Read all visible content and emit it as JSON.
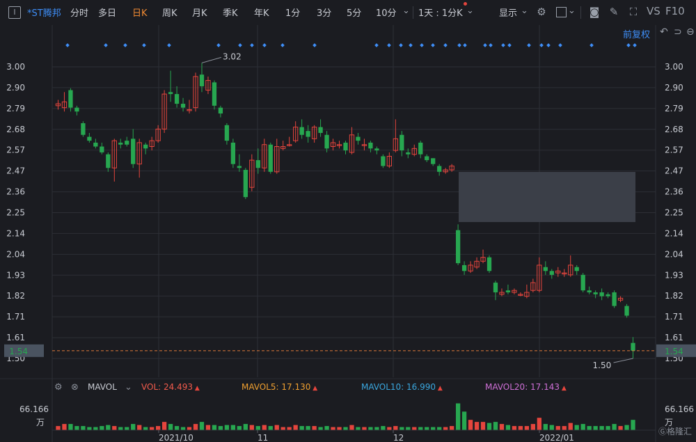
{
  "toolbar": {
    "title_icon": "window-icon",
    "stock_name": "*ST腾邦",
    "periods": [
      "分时",
      "多日",
      "日K",
      "周K",
      "月K",
      "季K",
      "年K",
      "1分",
      "3分",
      "5分",
      "10分"
    ],
    "active_period": "日K",
    "range_select": "1天 : 1分K",
    "display_label": "显示",
    "vs_label": "VS",
    "f10_label": "F10"
  },
  "chart_header": {
    "adjust_label": "前复权"
  },
  "price_axis": {
    "ticks": [
      "3.00",
      "2.90",
      "2.79",
      "2.68",
      "2.57",
      "2.47",
      "2.36",
      "2.25",
      "2.14",
      "2.04",
      "1.93",
      "1.82",
      "1.71",
      "1.61",
      "1.50"
    ],
    "current_price": "1.54",
    "high_label": "3.02",
    "low_label": "1.50"
  },
  "volume_axis": {
    "top_value": "66.166",
    "unit": "万"
  },
  "date_axis": {
    "labels": [
      "2021/10",
      "11",
      "12",
      "2022/01"
    ]
  },
  "indicator": {
    "name": "MAVOL",
    "vol": "VOL: 24.493",
    "mavol5": "MAVOL5: 17.130",
    "mavol10": "MAVOL10: 16.990",
    "mavol20": "MAVOL20: 17.143",
    "colors": {
      "vol": "#f25b4c",
      "mavol5": "#f0a030",
      "mavol10": "#3aa8e0",
      "mavol20": "#d070d8"
    }
  },
  "colors": {
    "up": "#e5453d",
    "down": "#27a750",
    "accent": "#3e8ef7",
    "active": "#f08a33",
    "background": "#1b1c21",
    "grid": "#2d2f36"
  },
  "chart_data": {
    "type": "candlestick",
    "ylim": [
      1.5,
      3.0
    ],
    "candles": [
      {
        "o": 2.8,
        "c": 2.81,
        "h": 2.83,
        "l": 2.78
      },
      {
        "o": 2.79,
        "c": 2.82,
        "h": 2.87,
        "l": 2.77
      },
      {
        "o": 2.88,
        "c": 2.79,
        "h": 2.89,
        "l": 2.77
      },
      {
        "o": 2.79,
        "c": 2.77,
        "h": 2.8,
        "l": 2.75
      },
      {
        "o": 2.71,
        "c": 2.65,
        "h": 2.72,
        "l": 2.64
      },
      {
        "o": 2.64,
        "c": 2.62,
        "h": 2.66,
        "l": 2.61
      },
      {
        "o": 2.61,
        "c": 2.59,
        "h": 2.63,
        "l": 2.58
      },
      {
        "o": 2.59,
        "c": 2.56,
        "h": 2.61,
        "l": 2.55
      },
      {
        "o": 2.55,
        "c": 2.48,
        "h": 2.56,
        "l": 2.46
      },
      {
        "o": 2.48,
        "c": 2.62,
        "h": 2.63,
        "l": 2.41
      },
      {
        "o": 2.61,
        "c": 2.6,
        "h": 2.63,
        "l": 2.58
      },
      {
        "o": 2.62,
        "c": 2.6,
        "h": 2.64,
        "l": 2.59
      },
      {
        "o": 2.63,
        "c": 2.5,
        "h": 2.68,
        "l": 2.48
      },
      {
        "o": 2.5,
        "c": 2.61,
        "h": 2.63,
        "l": 2.43
      },
      {
        "o": 2.6,
        "c": 2.58,
        "h": 2.61,
        "l": 2.55
      },
      {
        "o": 2.59,
        "c": 2.62,
        "h": 2.64,
        "l": 2.57
      },
      {
        "o": 2.62,
        "c": 2.68,
        "h": 2.7,
        "l": 2.61
      },
      {
        "o": 2.68,
        "c": 2.86,
        "h": 2.88,
        "l": 2.66
      },
      {
        "o": 2.87,
        "c": 2.86,
        "h": 2.98,
        "l": 2.82
      },
      {
        "o": 2.86,
        "c": 2.81,
        "h": 2.9,
        "l": 2.79
      },
      {
        "o": 2.81,
        "c": 2.79,
        "h": 2.84,
        "l": 2.77
      },
      {
        "o": 2.78,
        "c": 2.78,
        "h": 2.83,
        "l": 2.76
      },
      {
        "o": 2.79,
        "c": 2.95,
        "h": 2.97,
        "l": 2.77
      },
      {
        "o": 2.96,
        "c": 2.9,
        "h": 3.02,
        "l": 2.87
      },
      {
        "o": 2.88,
        "c": 2.93,
        "h": 2.95,
        "l": 2.86
      },
      {
        "o": 2.92,
        "c": 2.8,
        "h": 2.93,
        "l": 2.78
      },
      {
        "o": 2.79,
        "c": 2.76,
        "h": 2.8,
        "l": 2.74
      },
      {
        "o": 2.7,
        "c": 2.62,
        "h": 2.71,
        "l": 2.6
      },
      {
        "o": 2.61,
        "c": 2.5,
        "h": 2.63,
        "l": 2.48
      },
      {
        "o": 2.49,
        "c": 2.48,
        "h": 2.55,
        "l": 2.46
      },
      {
        "o": 2.47,
        "c": 2.33,
        "h": 2.48,
        "l": 2.32
      },
      {
        "o": 2.38,
        "c": 2.52,
        "h": 2.55,
        "l": 2.36
      },
      {
        "o": 2.52,
        "c": 2.48,
        "h": 2.58,
        "l": 2.45
      },
      {
        "o": 2.48,
        "c": 2.6,
        "h": 2.63,
        "l": 2.46
      },
      {
        "o": 2.6,
        "c": 2.46,
        "h": 2.61,
        "l": 2.45
      },
      {
        "o": 2.46,
        "c": 2.59,
        "h": 2.63,
        "l": 2.45
      },
      {
        "o": 2.58,
        "c": 2.59,
        "h": 2.62,
        "l": 2.57
      },
      {
        "o": 2.6,
        "c": 2.6,
        "h": 2.64,
        "l": 2.59
      },
      {
        "o": 2.62,
        "c": 2.69,
        "h": 2.72,
        "l": 2.61
      },
      {
        "o": 2.69,
        "c": 2.65,
        "h": 2.73,
        "l": 2.63
      },
      {
        "o": 2.67,
        "c": 2.64,
        "h": 2.7,
        "l": 2.61
      },
      {
        "o": 2.63,
        "c": 2.69,
        "h": 2.7,
        "l": 2.61
      },
      {
        "o": 2.69,
        "c": 2.66,
        "h": 2.73,
        "l": 2.64
      },
      {
        "o": 2.65,
        "c": 2.58,
        "h": 2.67,
        "l": 2.56
      },
      {
        "o": 2.59,
        "c": 2.61,
        "h": 2.63,
        "l": 2.57
      },
      {
        "o": 2.6,
        "c": 2.6,
        "h": 2.62,
        "l": 2.58
      },
      {
        "o": 2.61,
        "c": 2.57,
        "h": 2.62,
        "l": 2.55
      },
      {
        "o": 2.56,
        "c": 2.65,
        "h": 2.69,
        "l": 2.55
      },
      {
        "o": 2.64,
        "c": 2.62,
        "h": 2.66,
        "l": 2.6
      },
      {
        "o": 2.6,
        "c": 2.6,
        "h": 2.63,
        "l": 2.57
      },
      {
        "o": 2.61,
        "c": 2.58,
        "h": 2.62,
        "l": 2.56
      },
      {
        "o": 2.58,
        "c": 2.57,
        "h": 2.59,
        "l": 2.55
      },
      {
        "o": 2.54,
        "c": 2.49,
        "h": 2.55,
        "l": 2.48
      },
      {
        "o": 2.49,
        "c": 2.54,
        "h": 2.56,
        "l": 2.48
      },
      {
        "o": 2.57,
        "c": 2.63,
        "h": 2.73,
        "l": 2.56
      },
      {
        "o": 2.65,
        "c": 2.57,
        "h": 2.67,
        "l": 2.54
      },
      {
        "o": 2.56,
        "c": 2.55,
        "h": 2.58,
        "l": 2.53
      },
      {
        "o": 2.55,
        "c": 2.58,
        "h": 2.6,
        "l": 2.54
      },
      {
        "o": 2.61,
        "c": 2.55,
        "h": 2.62,
        "l": 2.53
      },
      {
        "o": 2.54,
        "c": 2.52,
        "h": 2.55,
        "l": 2.51
      },
      {
        "o": 2.53,
        "c": 2.5,
        "h": 2.53,
        "l": 2.49
      },
      {
        "o": 2.49,
        "c": 2.46,
        "h": 2.5,
        "l": 2.44
      },
      {
        "o": 2.46,
        "c": 2.47,
        "h": 2.48,
        "l": 2.45
      },
      {
        "o": 2.47,
        "c": 2.49,
        "h": 2.5,
        "l": 2.46
      },
      {
        "o": 2.16,
        "c": 1.99,
        "h": 2.19,
        "l": 1.98
      },
      {
        "o": 1.98,
        "c": 1.95,
        "h": 2.0,
        "l": 1.93
      },
      {
        "o": 1.95,
        "c": 1.98,
        "h": 2.0,
        "l": 1.94
      },
      {
        "o": 1.97,
        "c": 2.0,
        "h": 2.02,
        "l": 1.96
      },
      {
        "o": 2.0,
        "c": 2.02,
        "h": 2.06,
        "l": 1.99
      },
      {
        "o": 2.02,
        "c": 1.95,
        "h": 2.03,
        "l": 1.94
      },
      {
        "o": 1.89,
        "c": 1.84,
        "h": 1.9,
        "l": 1.8
      },
      {
        "o": 1.83,
        "c": 1.84,
        "h": 1.86,
        "l": 1.82
      },
      {
        "o": 1.85,
        "c": 1.84,
        "h": 1.88,
        "l": 1.83
      },
      {
        "o": 1.84,
        "c": 1.85,
        "h": 1.86,
        "l": 1.83
      },
      {
        "o": 1.83,
        "c": 1.83,
        "h": 1.84,
        "l": 1.82
      },
      {
        "o": 1.82,
        "c": 1.84,
        "h": 1.88,
        "l": 1.81
      },
      {
        "o": 1.85,
        "c": 1.89,
        "h": 1.91,
        "l": 1.84
      },
      {
        "o": 1.85,
        "c": 1.98,
        "h": 2.02,
        "l": 1.84
      },
      {
        "o": 1.97,
        "c": 1.95,
        "h": 2.0,
        "l": 1.93
      },
      {
        "o": 1.95,
        "c": 1.93,
        "h": 1.96,
        "l": 1.91
      },
      {
        "o": 1.94,
        "c": 1.95,
        "h": 1.97,
        "l": 1.92
      },
      {
        "o": 1.94,
        "c": 1.94,
        "h": 1.96,
        "l": 1.92
      },
      {
        "o": 1.93,
        "c": 1.98,
        "h": 2.03,
        "l": 1.92
      },
      {
        "o": 1.97,
        "c": 1.95,
        "h": 1.98,
        "l": 1.93
      },
      {
        "o": 1.93,
        "c": 1.85,
        "h": 1.94,
        "l": 1.84
      },
      {
        "o": 1.85,
        "c": 1.84,
        "h": 1.87,
        "l": 1.83
      },
      {
        "o": 1.84,
        "c": 1.83,
        "h": 1.85,
        "l": 1.81
      },
      {
        "o": 1.84,
        "c": 1.82,
        "h": 1.86,
        "l": 1.8
      },
      {
        "o": 1.83,
        "c": 1.82,
        "h": 1.84,
        "l": 1.81
      },
      {
        "o": 1.84,
        "c": 1.77,
        "h": 1.85,
        "l": 1.76
      },
      {
        "o": 1.8,
        "c": 1.81,
        "h": 1.82,
        "l": 1.79
      },
      {
        "o": 1.77,
        "c": 1.72,
        "h": 1.78,
        "l": 1.71
      },
      {
        "o": 1.58,
        "c": 1.54,
        "h": 1.61,
        "l": 1.5
      }
    ],
    "volume": [
      2,
      3,
      3,
      2,
      2,
      1.5,
      1.5,
      2,
      2.5,
      2,
      1.5,
      1.5,
      3,
      2.5,
      1.5,
      1.5,
      2,
      4,
      3,
      2,
      1.5,
      1.5,
      3,
      4,
      2.5,
      2.5,
      2,
      2.5,
      2.5,
      2,
      3,
      2.5,
      2,
      2.5,
      2,
      2.5,
      1.5,
      1.5,
      2.5,
      2,
      2,
      2,
      1.5,
      2,
      1.5,
      1.5,
      1.5,
      2.5,
      1.5,
      1.5,
      1.5,
      1.5,
      2,
      1.5,
      2,
      1.5,
      1.5,
      1.5,
      1.5,
      1.5,
      1.5,
      1.5,
      1.5,
      2,
      13,
      9,
      5,
      4,
      4,
      3.5,
      4,
      3,
      2.5,
      2,
      2,
      2,
      3,
      6,
      3,
      2.5,
      2,
      2,
      3.5,
      2.5,
      3,
      2,
      2,
      2,
      2,
      3,
      2,
      2.5,
      5
    ]
  }
}
